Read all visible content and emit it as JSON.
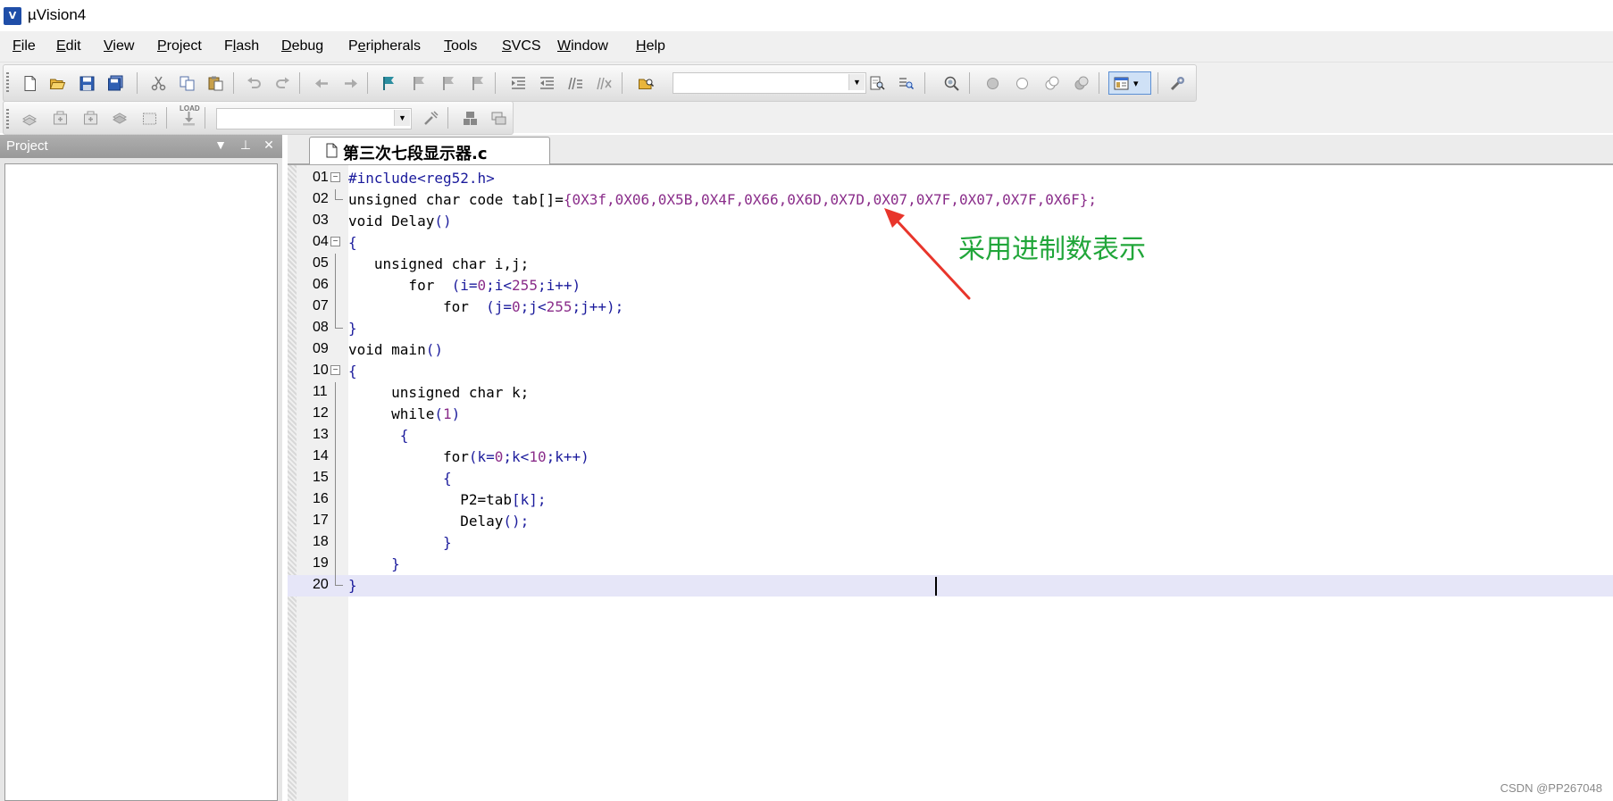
{
  "window": {
    "title": "µVision4",
    "icon": "V"
  },
  "menu": [
    {
      "label": "File",
      "accel_index": 0,
      "name": "menu-file"
    },
    {
      "label": "Edit",
      "accel_index": 0,
      "name": "menu-edit"
    },
    {
      "label": "View",
      "accel_index": 0,
      "name": "menu-view"
    },
    {
      "label": "Project",
      "accel_index": 0,
      "name": "menu-project"
    },
    {
      "label": "Flash",
      "accel_index": 1,
      "name": "menu-flash"
    },
    {
      "label": "Debug",
      "accel_index": 0,
      "name": "menu-debug"
    },
    {
      "label": "Peripherals",
      "accel_index": 1,
      "name": "menu-peripherals"
    },
    {
      "label": "Tools",
      "accel_index": 0,
      "name": "menu-tools"
    },
    {
      "label": "SVCS",
      "accel_index": 0,
      "name": "menu-svcs"
    },
    {
      "label": "Window",
      "accel_index": 0,
      "name": "menu-window"
    },
    {
      "label": "Help",
      "accel_index": 0,
      "name": "menu-help"
    }
  ],
  "toolbar1": {
    "icons": [
      "new-file-icon",
      "open-file-icon",
      "save-icon",
      "save-all-icon",
      "cut-icon",
      "copy-icon",
      "paste-icon",
      "undo-icon",
      "redo-icon",
      "navigate-back-icon",
      "navigate-forward-icon",
      "insert-bookmark-icon",
      "previous-bookmark-icon",
      "next-bookmark-icon",
      "clear-bookmarks-icon",
      "indent-icon",
      "unindent-icon",
      "comment-icon",
      "uncomment-icon",
      "find-in-files-icon",
      "find-icon",
      "incremental-find-icon",
      "zoom-icon",
      "debug-start-icon",
      "breakpoint-insert-icon",
      "breakpoint-enable-icon",
      "breakpoint-disable-icon",
      "window-layout-icon",
      "configure-icon"
    ],
    "find_combo_value": ""
  },
  "toolbar2": {
    "icons": [
      "translate-icon",
      "build-icon",
      "rebuild-icon",
      "batch-build-icon",
      "stop-build-icon",
      "download-icon",
      "target-options-icon",
      "manage-components-icon",
      "select-device-icon"
    ],
    "load_label": "LOAD",
    "target_combo_value": ""
  },
  "project_panel": {
    "title": "Project",
    "controls": [
      "▼",
      "⊥",
      "✕"
    ]
  },
  "editor": {
    "tab_label": "第三次七段显示器.c",
    "current_line": 20,
    "lines": [
      {
        "no": "01",
        "fold": "box",
        "text": [
          [
            "#include<reg52.h>",
            "#1b1b9c"
          ]
        ]
      },
      {
        "no": "02",
        "fold": "end",
        "text": [
          [
            "unsigned char code tab[]=",
            "#000000"
          ],
          [
            "{0X3f,0X06,0X5B,0X4F,0X66,0X6D,0X7D,0X07,0X7F,0X07,0X7F,0X6F};",
            "#8a2d8a"
          ]
        ]
      },
      {
        "no": "03",
        "fold": "",
        "text": [
          [
            "void Delay",
            "#000000"
          ],
          [
            "()",
            "#1b1b9c"
          ]
        ]
      },
      {
        "no": "04",
        "fold": "box",
        "text": [
          [
            "{",
            "#1b1b9c"
          ]
        ]
      },
      {
        "no": "05",
        "fold": "line",
        "text": [
          [
            "   unsigned char i,j;",
            "#000000"
          ]
        ]
      },
      {
        "no": "06",
        "fold": "line",
        "text": [
          [
            "       for  ",
            "#000000"
          ],
          [
            "(i=",
            "#1b1b9c"
          ],
          [
            "0",
            "#8a2d8a"
          ],
          [
            ";i<",
            "#1b1b9c"
          ],
          [
            "255",
            "#8a2d8a"
          ],
          [
            ";i++)",
            "#1b1b9c"
          ]
        ]
      },
      {
        "no": "07",
        "fold": "line",
        "text": [
          [
            "           for  ",
            "#000000"
          ],
          [
            "(j=",
            "#1b1b9c"
          ],
          [
            "0",
            "#8a2d8a"
          ],
          [
            ";j<",
            "#1b1b9c"
          ],
          [
            "255",
            "#8a2d8a"
          ],
          [
            ";j++);",
            "#1b1b9c"
          ]
        ]
      },
      {
        "no": "08",
        "fold": "end",
        "text": [
          [
            "}",
            "#1b1b9c"
          ]
        ]
      },
      {
        "no": "09",
        "fold": "",
        "text": [
          [
            "void main",
            "#000000"
          ],
          [
            "()",
            "#1b1b9c"
          ]
        ]
      },
      {
        "no": "10",
        "fold": "box",
        "text": [
          [
            "{",
            "#1b1b9c"
          ]
        ]
      },
      {
        "no": "11",
        "fold": "line",
        "text": [
          [
            "     unsigned char k;",
            "#000000"
          ]
        ]
      },
      {
        "no": "12",
        "fold": "line",
        "text": [
          [
            "     while",
            "#000000"
          ],
          [
            "(",
            "#1b1b9c"
          ],
          [
            "1",
            "#8a2d8a"
          ],
          [
            ")",
            "#1b1b9c"
          ]
        ]
      },
      {
        "no": "13",
        "fold": "line",
        "text": [
          [
            "      {",
            "#1b1b9c"
          ]
        ]
      },
      {
        "no": "14",
        "fold": "line",
        "text": [
          [
            "           for",
            "#000000"
          ],
          [
            "(k=",
            "#1b1b9c"
          ],
          [
            "0",
            "#8a2d8a"
          ],
          [
            ";k<",
            "#1b1b9c"
          ],
          [
            "10",
            "#8a2d8a"
          ],
          [
            ";k++)",
            "#1b1b9c"
          ]
        ]
      },
      {
        "no": "15",
        "fold": "line",
        "text": [
          [
            "           {",
            "#1b1b9c"
          ]
        ]
      },
      {
        "no": "16",
        "fold": "line",
        "text": [
          [
            "             P2=tab",
            "#000000"
          ],
          [
            "[k];",
            "#1b1b9c"
          ]
        ]
      },
      {
        "no": "17",
        "fold": "line",
        "text": [
          [
            "             Delay",
            "#000000"
          ],
          [
            "();",
            "#1b1b9c"
          ]
        ]
      },
      {
        "no": "18",
        "fold": "line",
        "text": [
          [
            "           }",
            "#1b1b9c"
          ]
        ]
      },
      {
        "no": "19",
        "fold": "line",
        "text": [
          [
            "     }",
            "#1b1b9c"
          ]
        ]
      },
      {
        "no": "20",
        "fold": "end",
        "text": [
          [
            "}",
            "#1b1b9c"
          ]
        ]
      }
    ]
  },
  "annotation": {
    "text": "采用进制数表示",
    "color": "#21a63a",
    "arrow_color": "#e8352b"
  },
  "watermark": "CSDN @PP267048",
  "colors": {
    "keyword": "#000000",
    "operator": "#1b1b9c",
    "number": "#8a2d8a",
    "current_line": "#e6e6f8"
  }
}
